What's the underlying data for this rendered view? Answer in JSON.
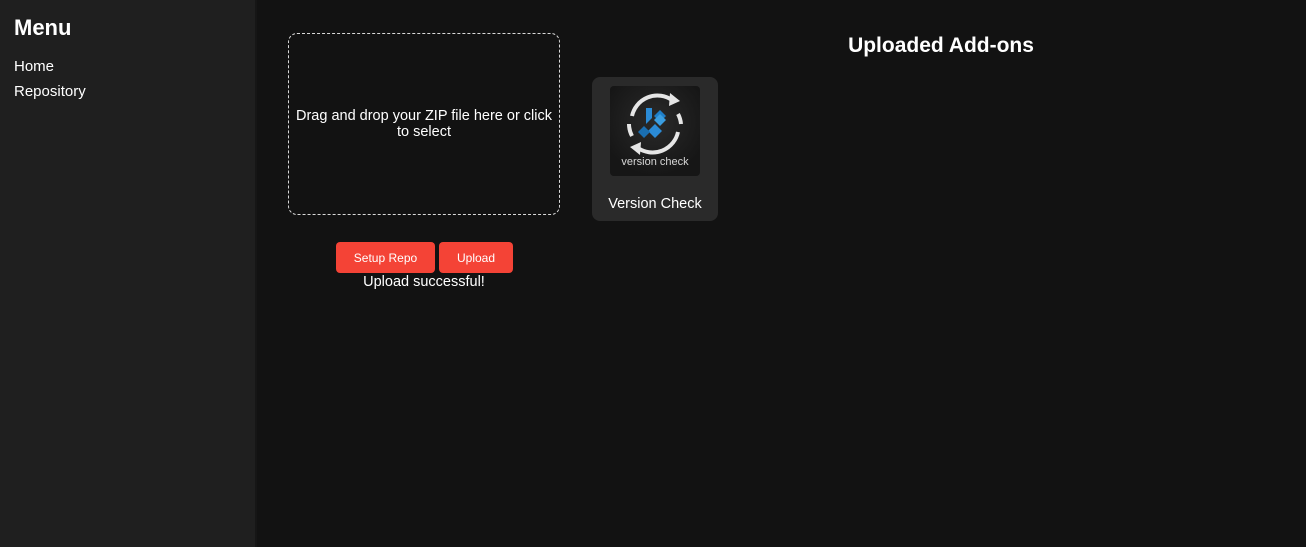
{
  "sidebar": {
    "title": "Menu",
    "items": [
      {
        "label": "Home"
      },
      {
        "label": "Repository"
      }
    ]
  },
  "upload": {
    "dropzone_text": "Drag and drop your ZIP file here or click to select",
    "setup_repo_label": "Setup Repo",
    "upload_label": "Upload",
    "status_text": "Upload successful!"
  },
  "addons": {
    "title": "Uploaded Add-ons",
    "items": [
      {
        "name": "Version Check",
        "thumb_text": "version check",
        "icon": "kodi-refresh-icon"
      }
    ]
  },
  "colors": {
    "accent": "#f44336",
    "background": "#121212",
    "sidebar": "#1f1f1f",
    "card": "#2a2a2a",
    "kodi_blue": "#2b8bd6"
  }
}
